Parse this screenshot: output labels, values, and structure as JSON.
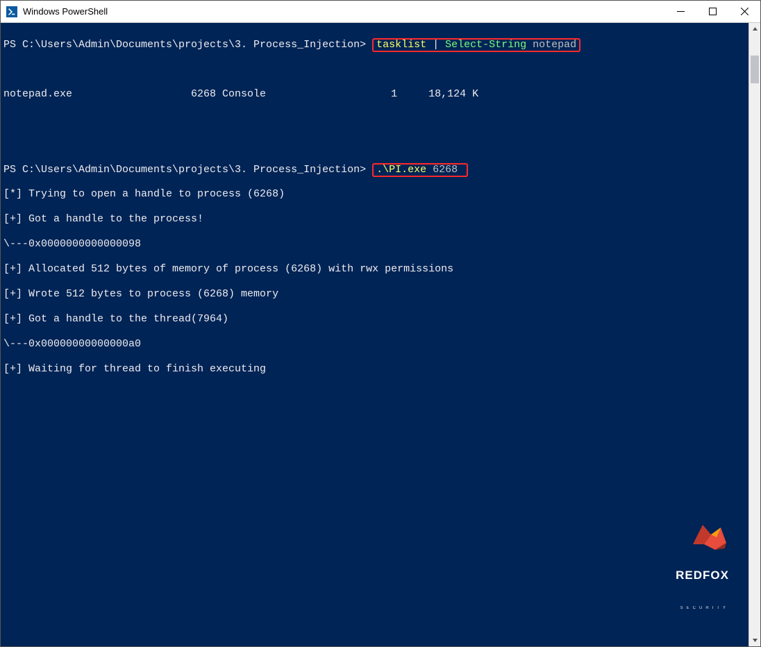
{
  "window": {
    "title": "Windows PowerShell"
  },
  "terminal": {
    "prompt1": "PS C:\\Users\\Admin\\Documents\\projects\\3. Process_Injection> ",
    "cmd1_a": "tasklist",
    "cmd1_b": " | ",
    "cmd1_c": "Select-String",
    "cmd1_d": " notepad",
    "blank1": "",
    "tasklist_out": "notepad.exe                   6268 Console                    1     18,124 K",
    "blank2": "",
    "blank3": "",
    "prompt2": "PS C:\\Users\\Admin\\Documents\\projects\\3. Process_Injection> ",
    "cmd2_a": ".\\PI.exe",
    "cmd2_b": " 6268 ",
    "out_l1": "[*] Trying to open a handle to process (6268)",
    "out_l2": "[+] Got a handle to the process!",
    "out_l3": "\\---0x0000000000000098",
    "out_l4": "[+] Allocated 512 bytes of memory of process (6268) with rwx permissions",
    "out_l5": "[+] Wrote 512 bytes to process (6268) memory",
    "out_l6": "[+] Got a handle to the thread(7964)",
    "out_l7": "\\---0x00000000000000a0",
    "out_l8": "[+] Waiting for thread to finish executing"
  },
  "watermark": {
    "brand": "REDFOX",
    "sub": "SECURITY"
  }
}
